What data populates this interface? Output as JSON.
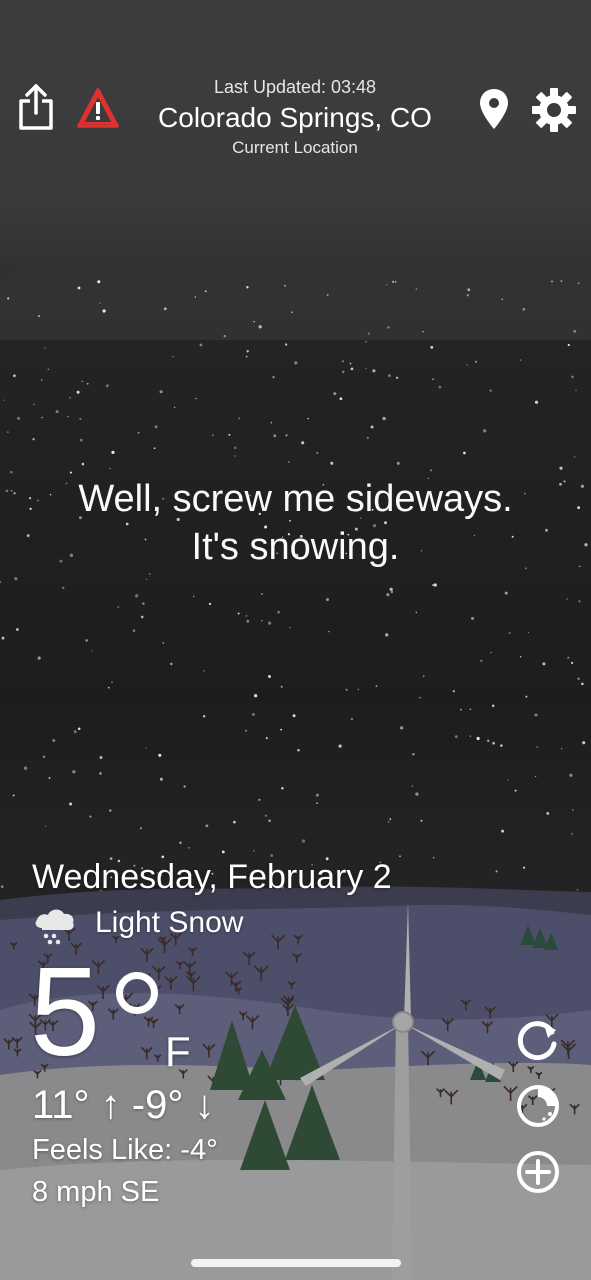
{
  "header": {
    "last_updated": "Last Updated: 03:48",
    "city": "Colorado Springs, CO",
    "location_type": "Current Location"
  },
  "quote": {
    "line1": "Well, screw me sideways.",
    "line2": "It's snowing."
  },
  "weather": {
    "date": "Wednesday, February 2",
    "condition": "Light Snow",
    "condition_icon": "cloud-snow-icon",
    "temperature": "5",
    "unit": "F",
    "hi_lo": "11° ↑ -9° ↓",
    "feels_like": "Feels Like: -4°",
    "wind": "8 mph SE"
  },
  "icons": {
    "share": "share-icon",
    "alert": "alert-triangle-icon",
    "location": "location-pin-icon",
    "settings": "gear-icon",
    "refresh": "refresh-icon",
    "radar": "radar-icon",
    "add": "add-icon"
  },
  "colors": {
    "alert": "#e2302e",
    "sky": "#1d1d1e",
    "ground_far": "#4d4f6a",
    "ground_near": "#8a8a8c"
  }
}
